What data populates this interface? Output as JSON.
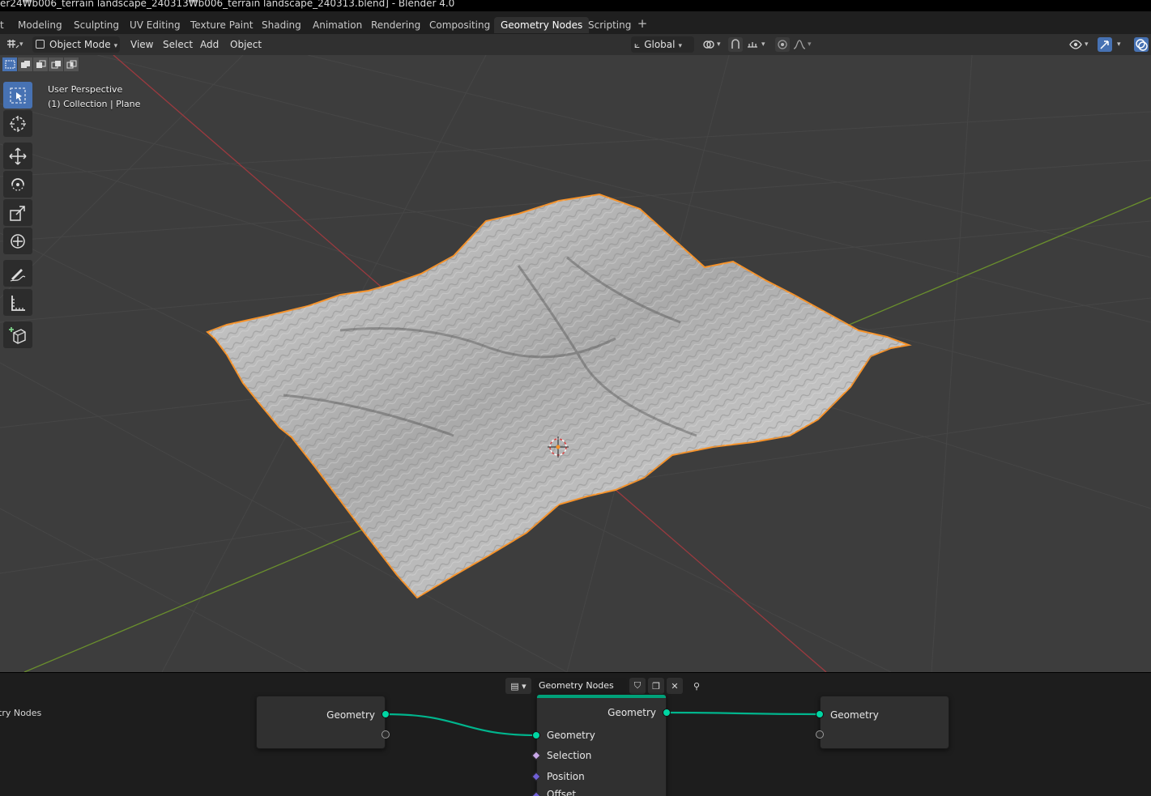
{
  "window": {
    "title": "er24₩b006_terrain landscape_240313₩b006_terrain landscape_240313.blend] - Blender 4.0"
  },
  "workspace_tabs": [
    {
      "label": "t",
      "active": false
    },
    {
      "label": "Modeling",
      "active": false
    },
    {
      "label": "Sculpting",
      "active": false
    },
    {
      "label": "UV Editing",
      "active": false
    },
    {
      "label": "Texture Paint",
      "active": false
    },
    {
      "label": "Shading",
      "active": false
    },
    {
      "label": "Animation",
      "active": false
    },
    {
      "label": "Rendering",
      "active": false
    },
    {
      "label": "Compositing",
      "active": false
    },
    {
      "label": "Geometry Nodes",
      "active": true
    },
    {
      "label": "Scripting",
      "active": false
    }
  ],
  "viewport_header": {
    "mode": "Object Mode",
    "menus": [
      "View",
      "Select",
      "Add",
      "Object"
    ],
    "transform_orientation": "Global"
  },
  "viewport": {
    "perspective": "User Perspective",
    "collection_info": "(1) Collection | Plane",
    "accent_color": "#4772b3",
    "selection_outline_color": "#f5922a",
    "x_axis_color": "#9c3a3f",
    "y_axis_color": "#6a8f2d"
  },
  "toolbar": [
    {
      "name": "select-box-tool",
      "active": true
    },
    {
      "name": "cursor-tool",
      "active": false
    },
    {
      "name": "move-tool",
      "active": false
    },
    {
      "name": "rotate-tool",
      "active": false
    },
    {
      "name": "scale-tool",
      "active": false
    },
    {
      "name": "transform-tool",
      "active": false
    },
    {
      "name": "annotate-tool",
      "active": false
    },
    {
      "name": "measure-tool",
      "active": false
    },
    {
      "name": "add-cube-tool",
      "active": false
    }
  ],
  "node_editor": {
    "node_group": "Geometry Nodes",
    "left_panel_label": "try Nodes",
    "input_node": {
      "output_label": "Geometry"
    },
    "middle_node": {
      "output_label": "Geometry",
      "inputs": [
        "Geometry",
        "Selection",
        "Position",
        "Offset"
      ]
    },
    "output_node": {
      "input_label": "Geometry"
    }
  }
}
